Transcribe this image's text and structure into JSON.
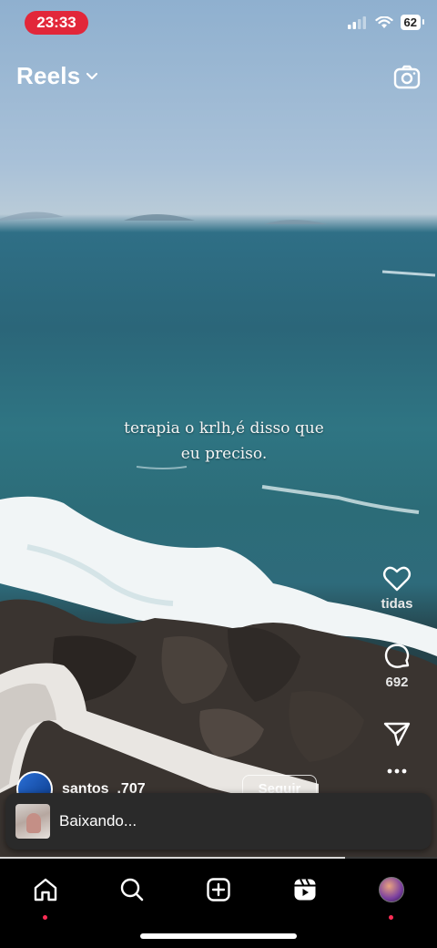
{
  "status_bar": {
    "time": "23:33",
    "battery": "62"
  },
  "header": {
    "title": "Reels"
  },
  "reel": {
    "caption_line1": "terapia o krlh,é disso que",
    "caption_line2": "eu preciso.",
    "likes_label": "tidas",
    "comment_count": "692",
    "author": "santos_.707",
    "follow_label": "Seguir",
    "progress": 0.79
  },
  "toast": {
    "text": "Baixando..."
  },
  "nav": {
    "items": [
      "home-icon",
      "search-icon",
      "create-icon",
      "reels-icon",
      "profile-avatar"
    ]
  },
  "colors": {
    "status_red": "#e2273a",
    "notification_dot": "#ff2d55",
    "toast_bg": "#2a2a2a"
  }
}
